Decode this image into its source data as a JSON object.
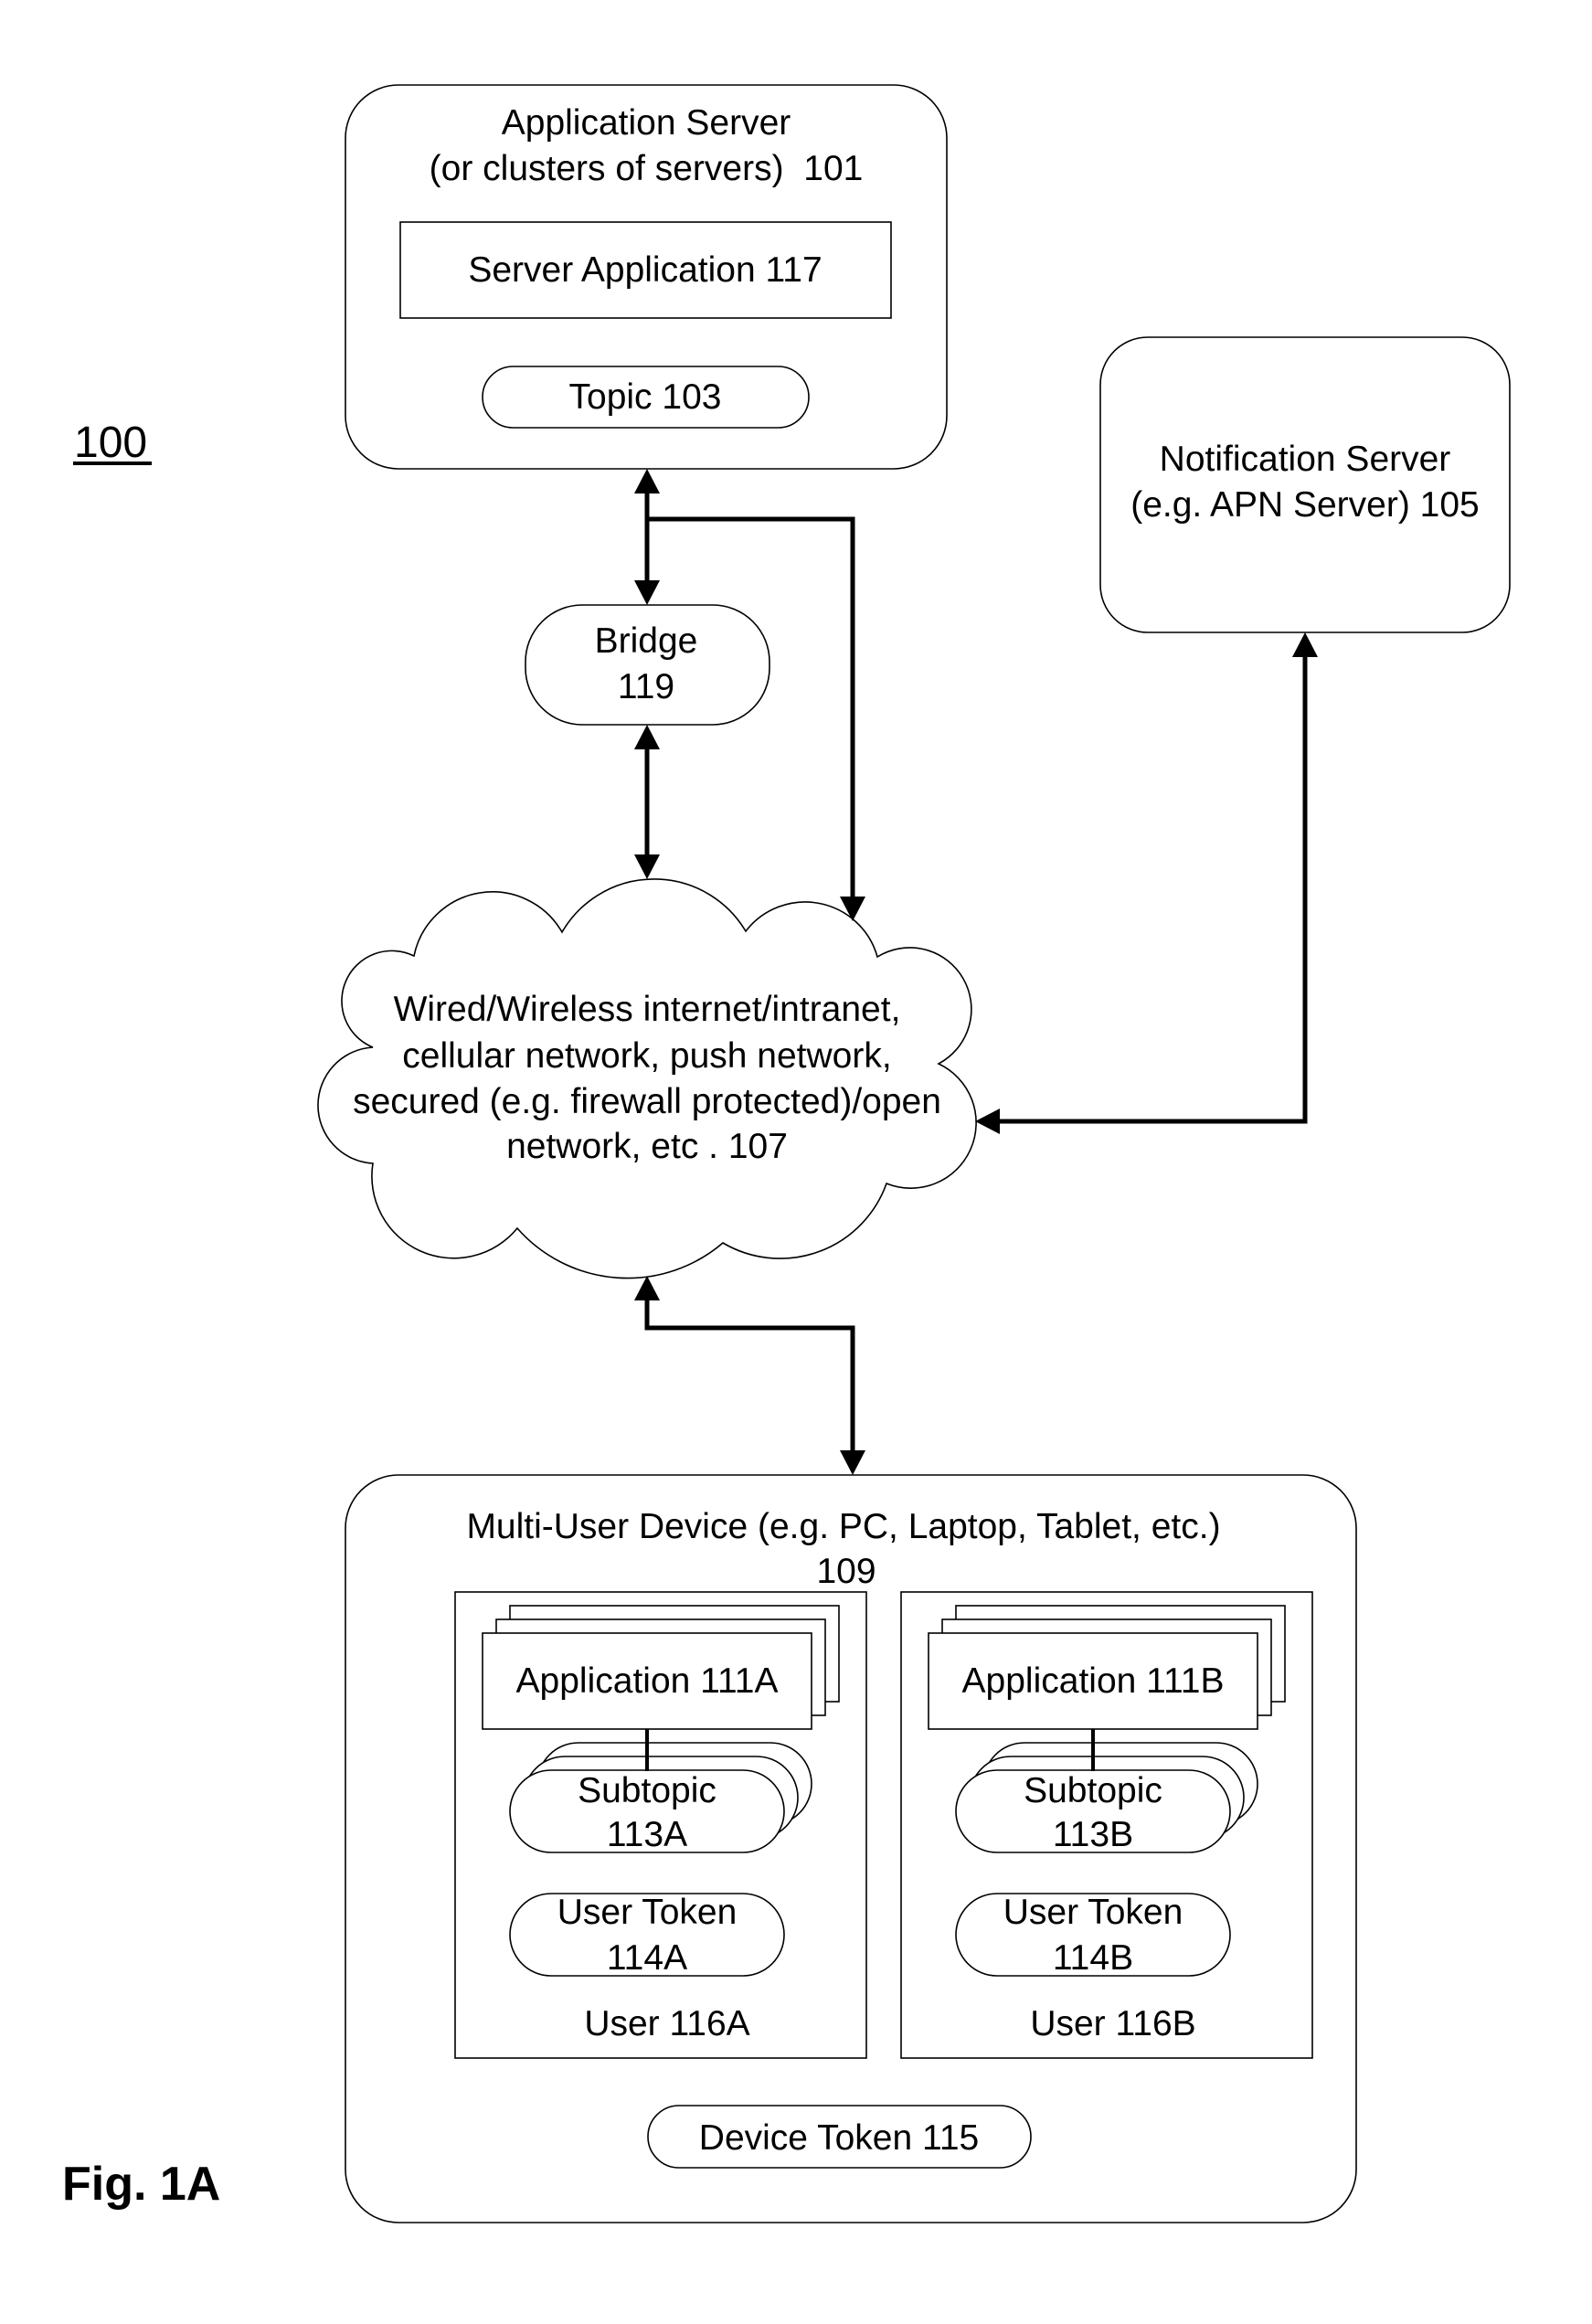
{
  "figure": {
    "reference_numeral": "100",
    "caption": "Fig. 1A"
  },
  "application_server": {
    "title_line1": "Application Server",
    "title_line2": "(or clusters of servers)  101",
    "server_application": "Server Application 117",
    "topic": "Topic 103"
  },
  "notification_server": {
    "line1": "Notification Server",
    "line2": "(e.g. APN Server) 105"
  },
  "bridge": {
    "line1": "Bridge",
    "line2": "119"
  },
  "network": {
    "lines": [
      "Wired/Wireless internet/intranet,",
      "cellular network, push network,",
      "secured (e.g. firewall protected)/open",
      "network, etc . 107"
    ]
  },
  "device": {
    "title_line1": "Multi-User Device (e.g. PC, Laptop, Tablet, etc.)",
    "title_line2": "109",
    "device_token": "Device Token 115",
    "users": [
      {
        "application": "Application 111A",
        "subtopic_line1": "Subtopic",
        "subtopic_line2": "113A",
        "user_token_line1": "User Token",
        "user_token_line2": "114A",
        "user_label": "User 116A"
      },
      {
        "application": "Application 111B",
        "subtopic_line1": "Subtopic",
        "subtopic_line2": "113B",
        "user_token_line1": "User Token",
        "user_token_line2": "114B",
        "user_label": "User 116B"
      }
    ]
  },
  "connections": [
    {
      "from": "application_server",
      "to": "bridge",
      "type": "bidirectional"
    },
    {
      "from": "application_server",
      "to": "network",
      "type": "bidirectional-branch"
    },
    {
      "from": "bridge",
      "to": "network",
      "type": "bidirectional"
    },
    {
      "from": "notification_server",
      "to": "network",
      "type": "bidirectional"
    },
    {
      "from": "network",
      "to": "device",
      "type": "bidirectional"
    },
    {
      "from": "application",
      "to": "subtopic",
      "type": "link"
    }
  ],
  "colors": {
    "stroke": "#000000",
    "background": "#ffffff"
  }
}
